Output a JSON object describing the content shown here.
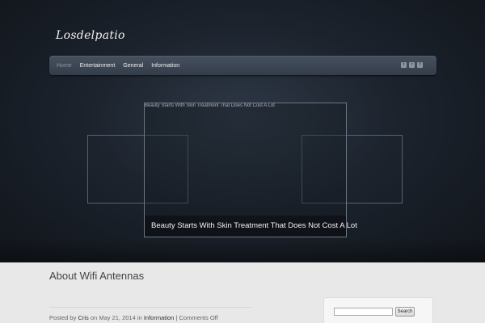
{
  "site": {
    "logo": "Losdelpatio"
  },
  "nav": {
    "items": [
      {
        "label": "Home",
        "active": true
      },
      {
        "label": "Entertainment",
        "active": false
      },
      {
        "label": "General",
        "active": false
      },
      {
        "label": "Information",
        "active": false
      }
    ],
    "social": [
      {
        "icon": "twitter-icon",
        "glyph": "t"
      },
      {
        "icon": "rss-icon",
        "glyph": "r"
      },
      {
        "icon": "facebook-icon",
        "glyph": "f"
      }
    ]
  },
  "slider": {
    "alt_text": "Beauty Starts With Skin Treatment That Does Not Cost A Lot",
    "caption": "Beauty Starts With Skin Treatment That Does Not Cost A Lot"
  },
  "post": {
    "title": "About Wifi Antennas",
    "posted_by": "Posted by",
    "author": "Cris",
    "on": "on",
    "date": "May 21, 2014",
    "in": "in",
    "category": "Information",
    "separator": "|",
    "comments": "Comments Off"
  },
  "search": {
    "placeholder": "",
    "button_label": "Search"
  }
}
